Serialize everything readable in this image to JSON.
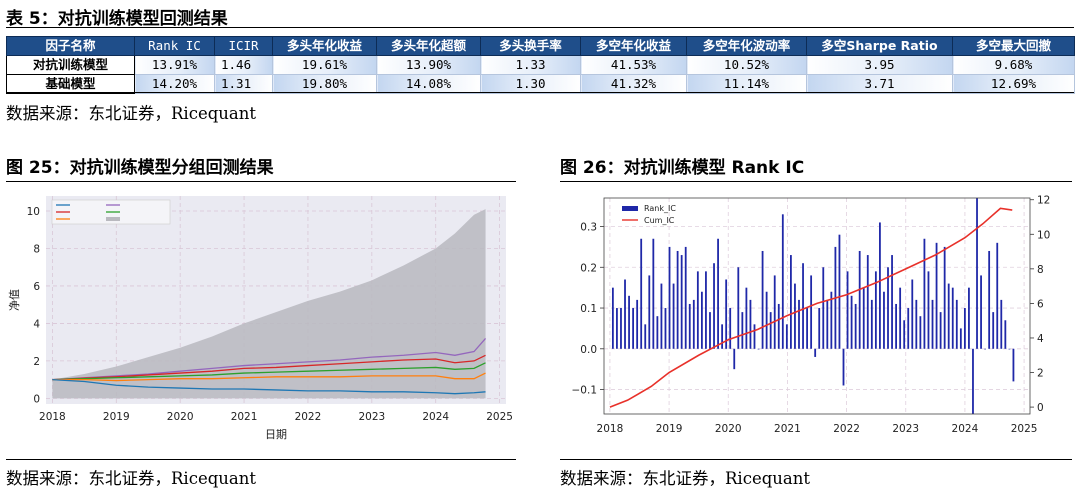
{
  "table": {
    "caption": "表 5：对抗训练模型回测结果",
    "headers": [
      "因子名称",
      "Rank IC",
      "ICIR",
      "多头年化收益",
      "多头年化超额",
      "多头换手率",
      "多空年化收益",
      "多空年化波动率",
      "多空Sharpe Ratio",
      "多空最大回撤"
    ],
    "rows": [
      [
        "对抗训练模型",
        "13.91%",
        "1.46",
        "19.61%",
        "13.90%",
        "1.33",
        "41.53%",
        "10.52%",
        "3.95",
        "9.68%"
      ],
      [
        "基础模型",
        "14.20%",
        "1.31",
        "19.80%",
        "14.08%",
        "1.30",
        "41.32%",
        "11.14%",
        "3.71",
        "12.69%"
      ]
    ],
    "source": "数据来源：东北证券，Ricequant"
  },
  "fig25": {
    "caption": "图 25：对抗训练模型分组回测结果",
    "source": "数据来源：东北证券，Ricequant"
  },
  "fig26": {
    "caption": "图 26：对抗训练模型 Rank IC",
    "source": "数据来源：东北证券，Ricequant"
  },
  "chart_data": [
    {
      "type": "line",
      "xlabel": "日期",
      "ylabel": "净值",
      "x_ticks": [
        "2018",
        "2019",
        "2020",
        "2021",
        "2022",
        "2023",
        "2024",
        "2025"
      ],
      "y_ticks": [
        "0",
        "2",
        "4",
        "6",
        "8",
        "10"
      ],
      "xlim": [
        2017.9,
        2025.1
      ],
      "ylim": [
        -0.3,
        10.8
      ],
      "grid": true,
      "legend_position": "top-left",
      "x": [
        2018.0,
        2018.5,
        2019.0,
        2019.5,
        2020.0,
        2020.5,
        2021.0,
        2021.5,
        2022.0,
        2022.5,
        2023.0,
        2023.5,
        2024.0,
        2024.3,
        2024.6,
        2024.78
      ],
      "area": {
        "name": "",
        "color": "#b9b9bf",
        "values": [
          1.0,
          1.3,
          1.7,
          2.2,
          2.7,
          3.3,
          4.0,
          4.6,
          5.2,
          5.7,
          6.3,
          7.1,
          8.0,
          8.8,
          9.8,
          10.1
        ]
      },
      "series": [
        {
          "name": "",
          "color": "#9467bd",
          "values": [
            1.0,
            1.1,
            1.2,
            1.3,
            1.45,
            1.6,
            1.75,
            1.85,
            1.95,
            2.05,
            2.2,
            2.3,
            2.45,
            2.3,
            2.5,
            3.2
          ]
        },
        {
          "name": "",
          "color": "#d62728",
          "values": [
            1.0,
            1.08,
            1.15,
            1.25,
            1.35,
            1.45,
            1.6,
            1.65,
            1.75,
            1.85,
            1.95,
            2.05,
            2.1,
            1.9,
            2.0,
            2.3
          ]
        },
        {
          "name": "",
          "color": "#2ca02c",
          "values": [
            1.0,
            1.05,
            1.1,
            1.15,
            1.2,
            1.25,
            1.35,
            1.4,
            1.45,
            1.5,
            1.55,
            1.6,
            1.65,
            1.55,
            1.6,
            1.9
          ]
        },
        {
          "name": "",
          "color": "#ff7f0e",
          "values": [
            1.0,
            1.0,
            0.95,
            1.0,
            1.05,
            1.05,
            1.1,
            1.15,
            1.15,
            1.15,
            1.2,
            1.2,
            1.2,
            1.05,
            1.05,
            1.35
          ]
        },
        {
          "name": "",
          "color": "#1f77b4",
          "values": [
            1.0,
            0.9,
            0.7,
            0.6,
            0.55,
            0.5,
            0.5,
            0.45,
            0.4,
            0.4,
            0.35,
            0.35,
            0.3,
            0.25,
            0.3,
            0.35
          ]
        }
      ]
    },
    {
      "type": "bar",
      "legend": [
        "Rank_IC",
        "Cum_IC"
      ],
      "legend_position": "top-left",
      "x_ticks": [
        "2018",
        "2019",
        "2020",
        "2021",
        "2022",
        "2023",
        "2024",
        "2025"
      ],
      "y_ticks_left": [
        "−0.1",
        "0.0",
        "0.1",
        "0.2",
        "0.3"
      ],
      "y_ticks_right": [
        "0",
        "2",
        "4",
        "6",
        "8",
        "10",
        "12"
      ],
      "xlim": [
        2017.9,
        2025.1
      ],
      "ylim_left": [
        -0.16,
        0.37
      ],
      "ylim_right": [
        -0.4,
        12.1
      ],
      "grid": true,
      "bar_color": "#1f28a8",
      "line_color": "#e8312a",
      "rank_ic": [
        0.15,
        0.1,
        0.1,
        0.17,
        0.13,
        0.1,
        0.12,
        0.27,
        0.06,
        0.18,
        0.27,
        0.08,
        0.16,
        0.1,
        0.25,
        0.16,
        0.24,
        0.23,
        0.25,
        0.11,
        0.12,
        0.19,
        0.14,
        0.19,
        0.09,
        0.21,
        0.27,
        0.06,
        0.17,
        0.1,
        -0.05,
        0.2,
        0.09,
        0.15,
        0.12,
        0.06,
        0.0,
        0.24,
        0.14,
        0.09,
        0.18,
        0.11,
        0.33,
        0.06,
        0.23,
        0.16,
        0.12,
        0.21,
        0.1,
        0.18,
        -0.02,
        0.1,
        0.2,
        0.12,
        0.14,
        0.25,
        0.28,
        -0.09,
        0.19,
        0.13,
        0.11,
        0.24,
        0.15,
        0.23,
        0.12,
        0.19,
        0.31,
        0.14,
        0.2,
        0.23,
        0.11,
        0.15,
        0.07,
        0.1,
        0.17,
        0.12,
        0.08,
        0.27,
        0.19,
        0.12,
        0.26,
        0.09,
        0.25,
        0.16,
        0.15,
        0.12,
        0.05,
        0.1,
        0.15,
        -0.16,
        0.37,
        0.18,
        0.0,
        0.24,
        0.09,
        0.26,
        0.12,
        0.07,
        0.0,
        -0.08
      ],
      "cum_x": [
        2018.0,
        2018.3,
        2018.7,
        2019.0,
        2019.5,
        2020.0,
        2020.5,
        2021.0,
        2021.5,
        2022.0,
        2022.5,
        2023.0,
        2023.5,
        2024.0,
        2024.3,
        2024.6,
        2024.8
      ],
      "cum_ic": [
        0.0,
        0.4,
        1.2,
        2.0,
        3.0,
        3.9,
        4.5,
        5.3,
        6.0,
        6.5,
        7.2,
        8.0,
        8.8,
        9.8,
        10.6,
        11.5,
        11.4
      ]
    }
  ]
}
